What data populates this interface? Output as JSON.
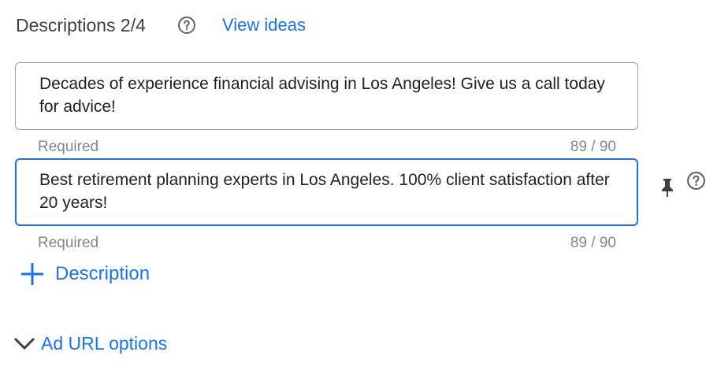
{
  "header": {
    "title": "Descriptions 2/4",
    "help_icon": "help-circle-icon",
    "view_ideas_label": "View ideas"
  },
  "descriptions": [
    {
      "text": "Decades of experience financial advising in Los Angeles! Give us a call today for advice!",
      "hint": "Required",
      "count": "89 / 90",
      "focused": false
    },
    {
      "text": "Best retirement planning experts in Los Angeles. 100% client satisfaction after 20 years!",
      "hint": "Required",
      "count": "89 / 90",
      "focused": true,
      "pin_icon": "pin-icon",
      "help_icon": "help-circle-icon"
    }
  ],
  "add_description": {
    "icon": "plus-icon",
    "label": "Description"
  },
  "ad_url_options": {
    "icon": "chevron-down-icon",
    "label": "Ad URL options"
  },
  "colors": {
    "accent": "#1a73e8",
    "text": "#202124",
    "muted": "#80868b",
    "border": "#9aa0a6"
  }
}
